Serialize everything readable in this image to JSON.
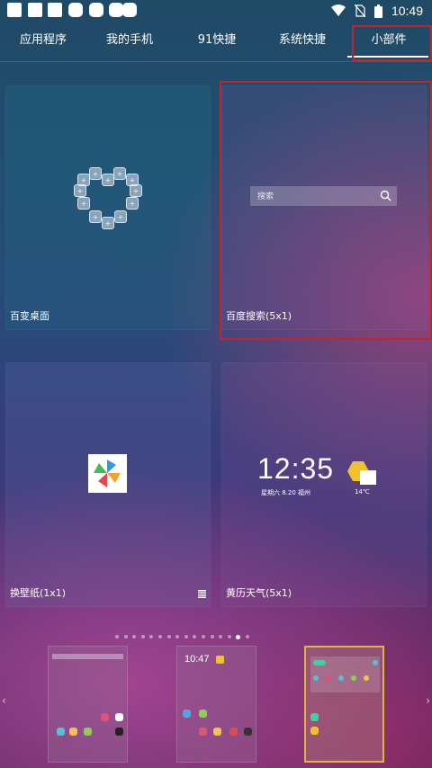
{
  "status_bar": {
    "time": "10:49"
  },
  "tabs": [
    {
      "label": "应用程序"
    },
    {
      "label": "我的手机"
    },
    {
      "label": "91快捷"
    },
    {
      "label": "系统快捷"
    },
    {
      "label": "小部件",
      "selected": true
    }
  ],
  "widgets": [
    {
      "label": "百变桌面",
      "icon": "heart-shape-icon"
    },
    {
      "label": "百度搜索(5x1)",
      "search_placeholder": "搜索",
      "icon": "search-icon",
      "highlighted": true
    },
    {
      "label": "换壁纸(1x1)",
      "icon": "pinwheel-icon",
      "corner_icon": "grid-icon"
    },
    {
      "label": "黄历天气(5x1)",
      "time": "12:35",
      "date_line": "星期六    8.20  福州",
      "temperature": "14℃",
      "icon": "weather-cloud-sun-icon"
    }
  ],
  "pagination": {
    "total": 16,
    "current": 14
  },
  "thumbnails": [
    {
      "label": "screen-1",
      "selected": false,
      "time": ""
    },
    {
      "label": "screen-2",
      "selected": false,
      "time": "10:47"
    },
    {
      "label": "screen-3",
      "selected": true,
      "time": ""
    }
  ],
  "colors": {
    "highlight_box": "#c0242f",
    "selected_thumbnail_border": "#e0b440"
  }
}
